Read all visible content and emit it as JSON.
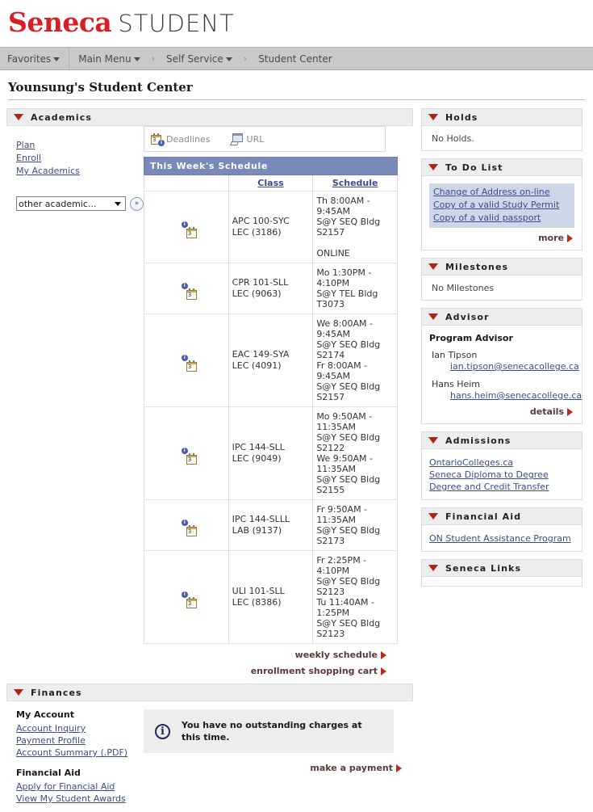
{
  "header": {
    "brand": "Seneca",
    "sub": "STUDENT"
  },
  "nav": {
    "favorites": "Favorites",
    "main_menu": "Main Menu",
    "self_service": "Self Service",
    "student_center": "Student Center",
    "separator": "›"
  },
  "page": {
    "title": "Younsung's Student Center"
  },
  "academics": {
    "title": "Academics",
    "links": [
      "Plan",
      "Enroll",
      "My Academics"
    ],
    "select_value": "other academic...",
    "go_label": "»",
    "legend": [
      {
        "label": "Deadlines",
        "icon": "calendar-deadline-icon"
      },
      {
        "label": "URL",
        "icon": "url-icon"
      }
    ],
    "schedule": {
      "heading": "This Week's Schedule",
      "columns": [
        "Class",
        "Schedule"
      ],
      "rows": [
        {
          "class": "APC 100-SYC",
          "component": "LEC (3186)",
          "schedule": [
            "Th 8:00AM - 9:45AM",
            "S@Y SEQ Bldg S2157",
            "",
            "ONLINE"
          ]
        },
        {
          "class": "CPR 101-SLL",
          "component": "LEC (9063)",
          "schedule": [
            "Mo 1:30PM - 4:10PM",
            "S@Y TEL Bldg T3073"
          ]
        },
        {
          "class": "EAC 149-SYA",
          "component": "LEC (4091)",
          "schedule": [
            "We 8:00AM - 9:45AM",
            "S@Y SEQ Bldg S2174",
            "Fr 8:00AM - 9:45AM",
            "S@Y SEQ Bldg S2157"
          ]
        },
        {
          "class": "IPC 144-SLL",
          "component": "LEC (9049)",
          "schedule": [
            "Mo 9:50AM -",
            "11:35AM",
            "S@Y SEQ Bldg S2122",
            "We 9:50AM -",
            "11:35AM",
            "S@Y SEQ Bldg S2155"
          ]
        },
        {
          "class": "IPC 144-SLLL",
          "component": "LAB (9137)",
          "schedule": [
            "Fr 9:50AM - 11:35AM",
            "S@Y SEQ Bldg S2173"
          ]
        },
        {
          "class": "ULI 101-SLL",
          "component": "LEC (8386)",
          "schedule": [
            "Fr 2:25PM - 4:10PM",
            "S@Y SEQ Bldg S2123",
            "Tu 11:40AM - 1:25PM",
            "S@Y SEQ Bldg S2123"
          ]
        }
      ]
    },
    "actions": [
      "weekly schedule",
      "enrollment shopping cart"
    ]
  },
  "finances": {
    "title": "Finances",
    "my_account_header": "My Account",
    "my_account_links": [
      "Account Inquiry",
      "Payment Profile",
      "Account Summary (.PDF)"
    ],
    "financial_aid_header": "Financial Aid",
    "financial_aid_links": [
      "Apply for Financial Aid",
      "View My Student Awards"
    ],
    "message": "You have no outstanding charges at this time.",
    "action": "make a payment"
  },
  "holds": {
    "title": "Holds",
    "text": "No Holds."
  },
  "todo": {
    "title": "To Do List",
    "items": [
      "Change of Address on-line",
      "Copy of a valid Study Permit",
      "Copy of a valid passport"
    ],
    "action": "more"
  },
  "milestones": {
    "title": "Milestones",
    "text": "No Milestones"
  },
  "advisor": {
    "title": "Advisor",
    "subtitle": "Program Advisor",
    "people": [
      {
        "name": "Ian Tipson",
        "email": "ian.tipson@senecacollege.ca"
      },
      {
        "name": "Hans Heim",
        "email": "hans.heim@senecacollege.ca"
      }
    ],
    "action": "details"
  },
  "admissions": {
    "title": "Admissions",
    "links": [
      "OntarioColleges.ca",
      "Seneca Diploma to Degree",
      "Degree and Credit Transfer"
    ]
  },
  "financial_aid": {
    "title": "Financial Aid",
    "links": [
      "ON Student Assistance Program"
    ]
  },
  "seneca_links": {
    "title": "Seneca Links"
  },
  "colors": {
    "brand_red": "#d81f26",
    "triangle_red": "#b02318",
    "arrow_red": "#c0271c",
    "link_blue": "#3d4c8c",
    "schedule_header": "#7a8ab8",
    "todo_bg": "#ccd7e8",
    "nav_bg": "#c9c9c9",
    "group_header_bg": "#ededed"
  }
}
